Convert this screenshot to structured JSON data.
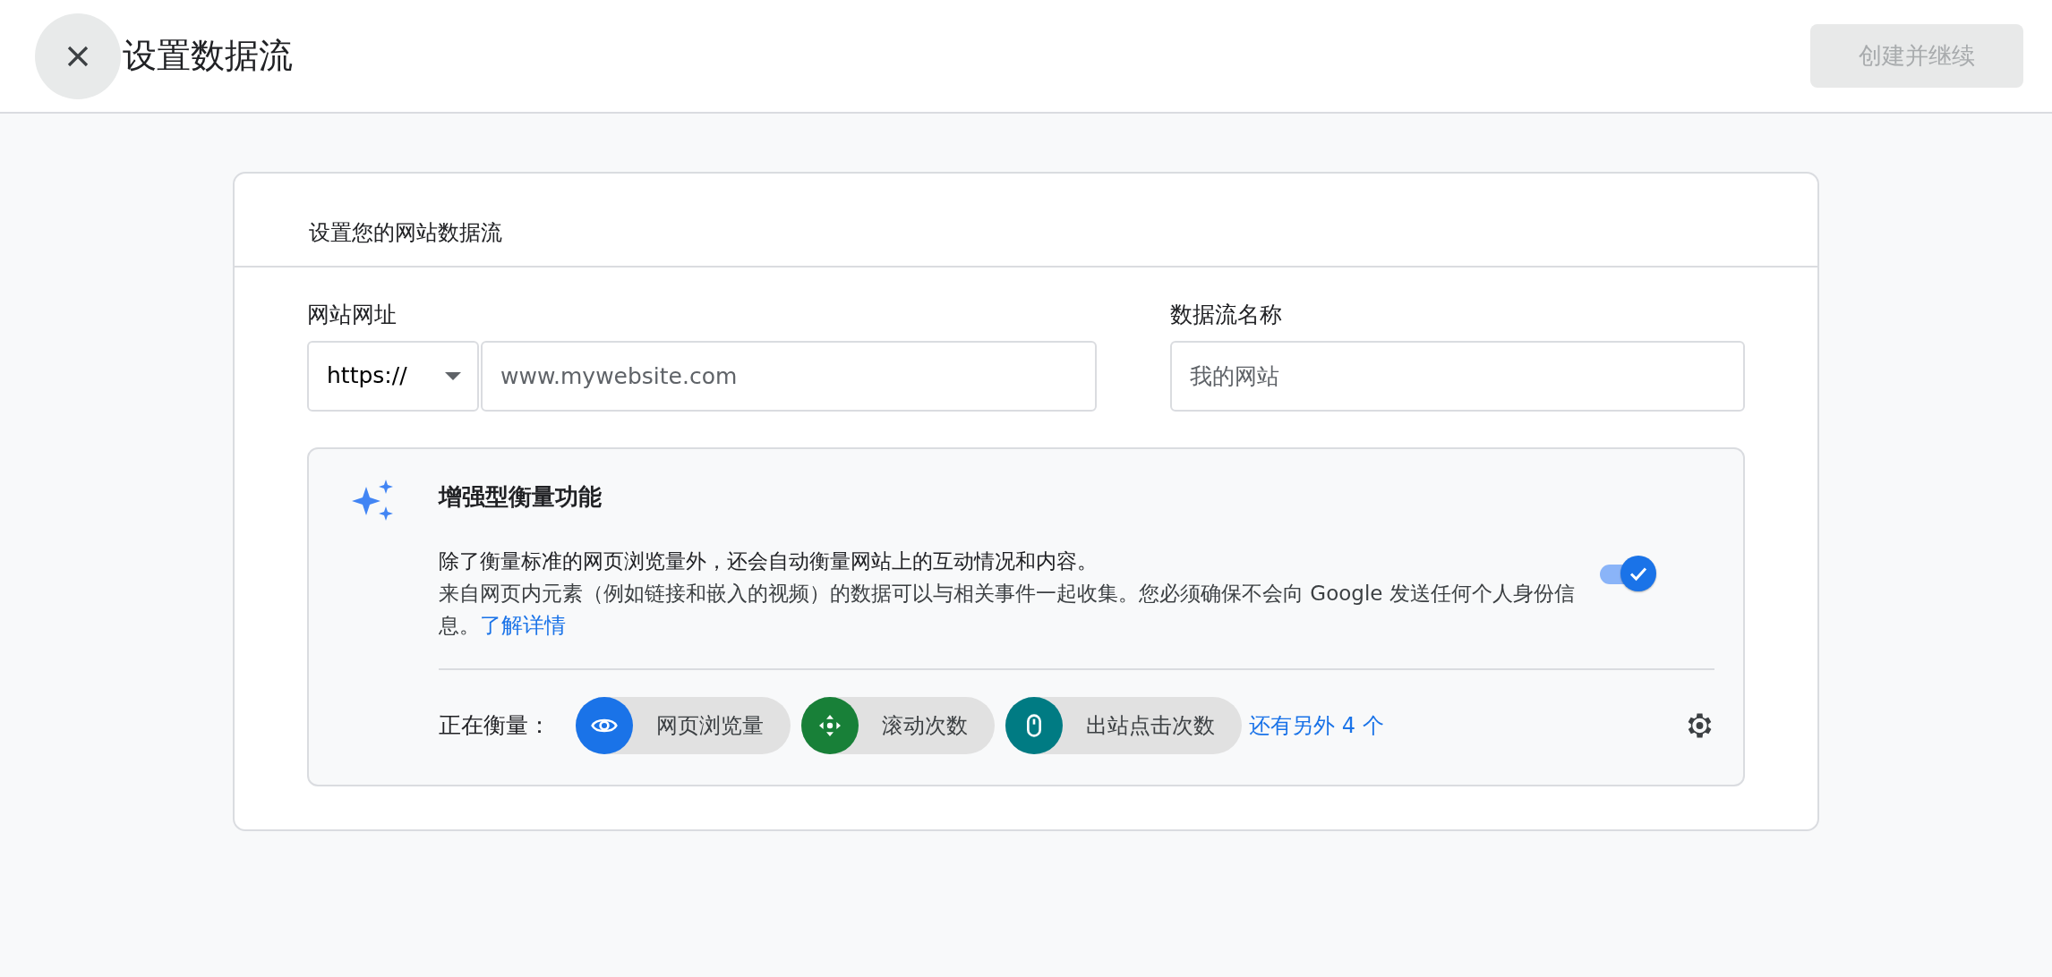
{
  "header": {
    "title": "设置数据流",
    "primary_button": {
      "label": "创建并继续",
      "disabled": true
    }
  },
  "card": {
    "title": "设置您的网站数据流",
    "url_field": {
      "label": "网站网址",
      "protocol": "https://",
      "placeholder": "www.mywebsite.com"
    },
    "name_field": {
      "label": "数据流名称",
      "placeholder": "我的网站"
    },
    "enhanced": {
      "title": "增强型衡量功能",
      "description": "除了衡量标准的网页浏览量外，还会自动衡量网站上的互动情况和内容。",
      "detail": "来自网页内元素（例如链接和嵌入的视频）的数据可以与相关事件一起收集。您必须确保不会向 Google 发送任何个人身份信息。",
      "link": "了解详情",
      "on": true,
      "measuring_label": "正在衡量：",
      "events": [
        {
          "label": "网页浏览量",
          "kind": "eye",
          "color": "#1a73e8"
        },
        {
          "label": "滚动次数",
          "kind": "scroll",
          "color": "#188038"
        },
        {
          "label": "出站点击次数",
          "kind": "mouse",
          "color": "#007b83"
        }
      ],
      "more_link": "还有另外 4 个"
    }
  }
}
